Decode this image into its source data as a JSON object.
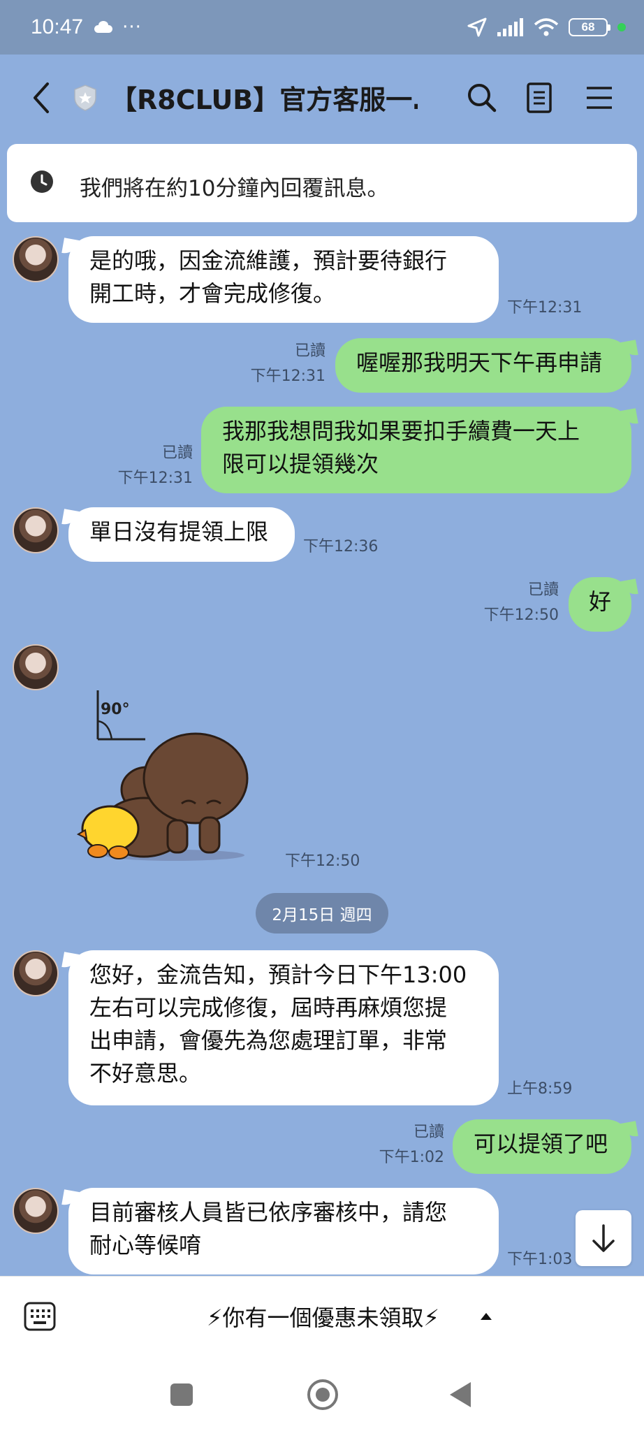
{
  "status_bar": {
    "time": "10:47",
    "dots": "···",
    "battery": "68"
  },
  "header": {
    "title": "【R8CLUB】官方客服一…"
  },
  "notice": {
    "text": "我們將在約10分鐘內回覆訊息。"
  },
  "messages": [
    {
      "side": "in",
      "text": "是的哦，因金流維護，預計要待銀行\n開工時，才會完成修復。",
      "time": "下午12:31"
    },
    {
      "side": "out",
      "text": "喔喔那我明天下午再申請",
      "read": "已讀",
      "time": "下午12:31"
    },
    {
      "side": "out",
      "text": "我那我想問我如果要扣手續費一天上\n限可以提領幾次",
      "read": "已讀",
      "time": "下午12:31"
    },
    {
      "side": "in",
      "text": "單日沒有提領上限",
      "time": "下午12:36"
    },
    {
      "side": "out",
      "text": "好",
      "read": "已讀",
      "time": "下午12:50"
    },
    {
      "side": "in",
      "type": "sticker",
      "sticker_text": "90°",
      "time": "下午12:50"
    },
    {
      "side": "in",
      "text": "您好，金流告知，預計今日下午13:00\n左右可以完成修復，屆時再麻煩您提\n出申請，會優先為您處理訂單，非常\n不好意思。",
      "time": "上午8:59"
    },
    {
      "side": "out",
      "text": "可以提領了吧",
      "read": "已讀",
      "time": "下午1:02"
    },
    {
      "side": "in",
      "text": "目前審核人員皆已依序審核中，請您\n耐心等候唷",
      "time": "下午1:03"
    }
  ],
  "date_divider": "2月15日 週四",
  "bottom_bar": {
    "promo": "⚡你有一個優惠未領取⚡"
  },
  "colors": {
    "chat_bg": "#8eaedd",
    "outgoing": "#98e08c",
    "incoming": "#ffffff",
    "status_bar": "#7d97ba"
  }
}
